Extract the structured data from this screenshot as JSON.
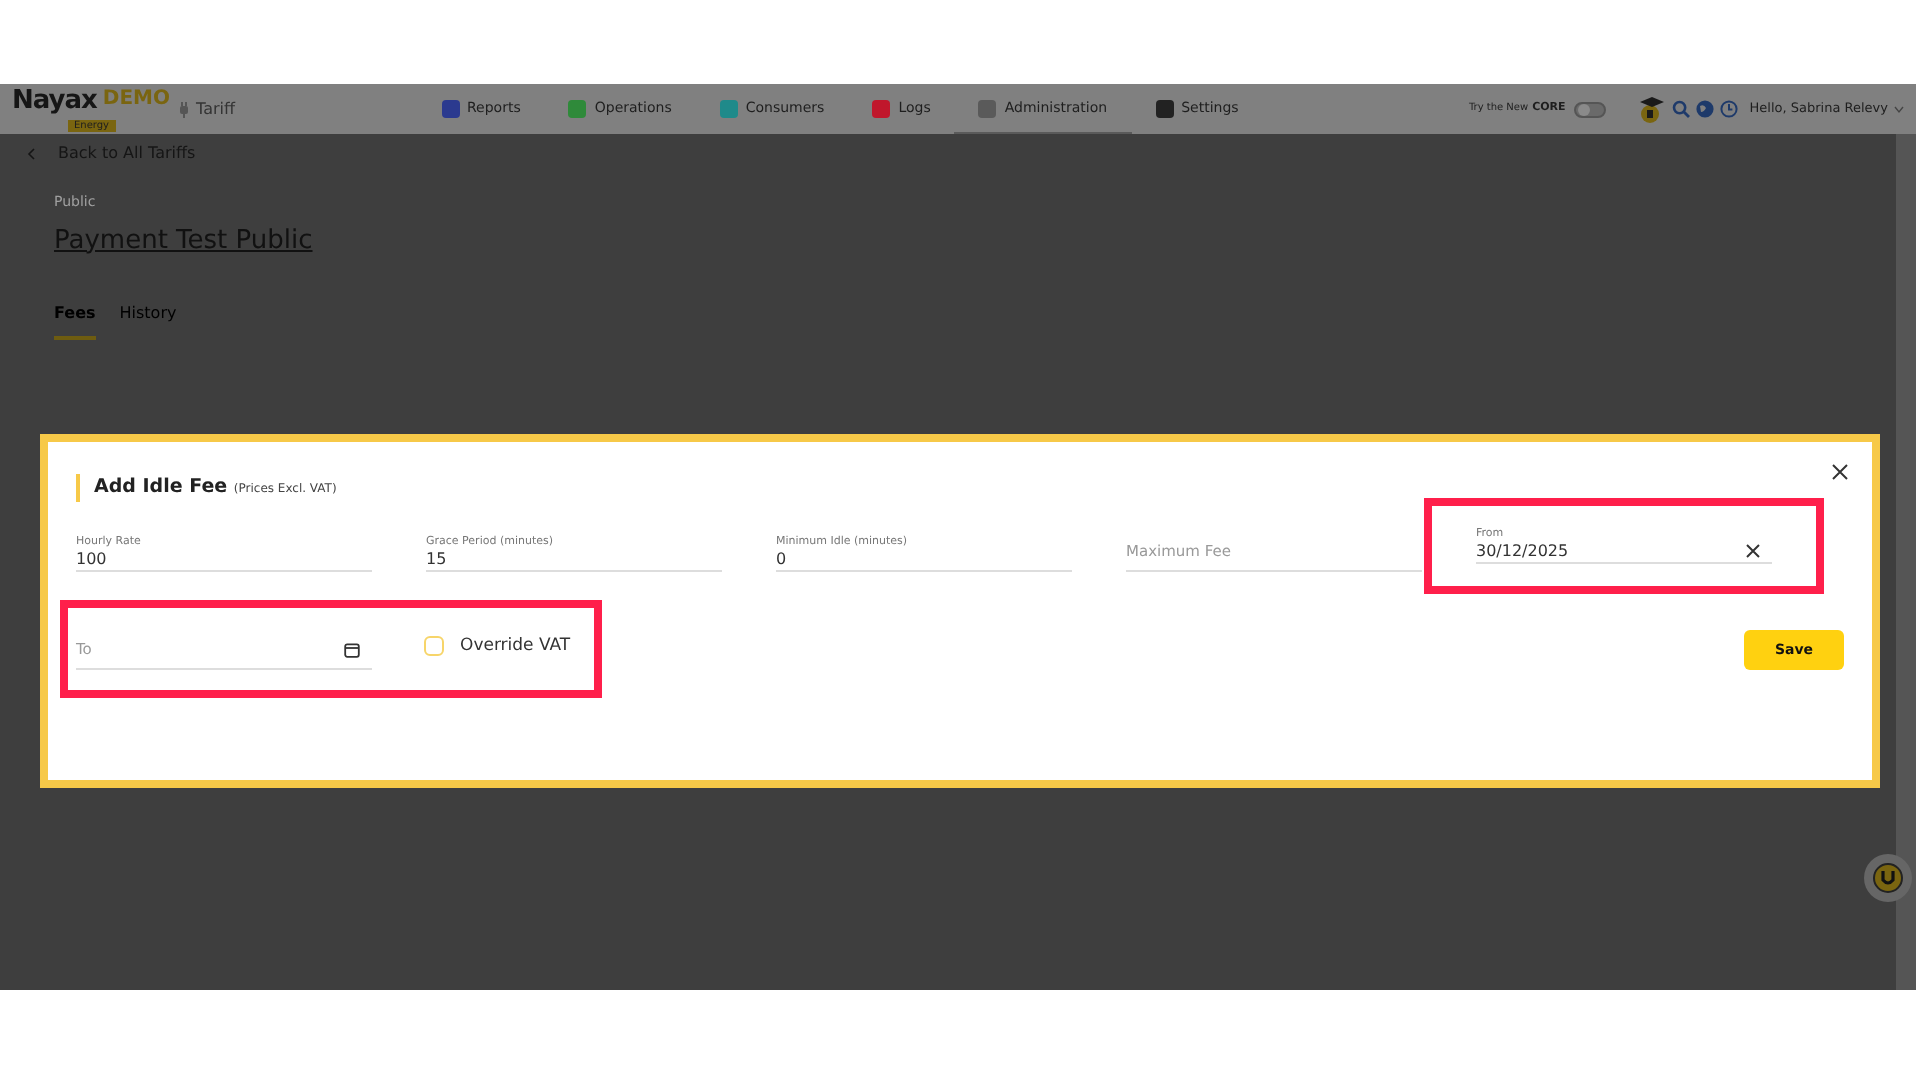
{
  "header": {
    "brand": "Nayax",
    "brand_tag": "DEMO",
    "brand_sub": "Energy",
    "section": "Tariff",
    "nav": [
      {
        "label": "Reports",
        "color": "#2b3a8f",
        "selected": false
      },
      {
        "label": "Operations",
        "color": "#2f8a3a",
        "selected": false
      },
      {
        "label": "Consumers",
        "color": "#1f8a8a",
        "selected": false
      },
      {
        "label": "Logs",
        "color": "#c0172c",
        "selected": false
      },
      {
        "label": "Administration",
        "color": "#5a5a5a",
        "selected": true
      },
      {
        "label": "Settings",
        "color": "#222222",
        "selected": false
      }
    ],
    "try_text": "Try the New",
    "try_brand": "CORE",
    "try_toggle": {
      "on": false
    },
    "user": "Hello, Sabrina Relevy"
  },
  "page": {
    "back": "Back to All Tariffs",
    "kicker": "Public",
    "title": "Payment Test Public",
    "tabs": [
      {
        "label": "Fees",
        "selected": true
      },
      {
        "label": "History",
        "selected": false
      }
    ]
  },
  "modal": {
    "title": "Add Idle Fee",
    "subtitle": "(Prices Excl. VAT)",
    "fields": [
      {
        "label": "Hourly Rate",
        "value": "100",
        "highlighted": false,
        "kind": "text"
      },
      {
        "label": "Grace Period (minutes)",
        "value": "15",
        "highlighted": false,
        "kind": "text"
      },
      {
        "label": "Minimum Idle (minutes)",
        "value": "0",
        "highlighted": false,
        "kind": "text"
      },
      {
        "placeholder": "Maximum Fee",
        "highlighted": false,
        "kind": "text"
      },
      {
        "label": "From",
        "value": "30/12/2025",
        "highlighted": true,
        "kind": "clearable"
      }
    ],
    "second_row": {
      "highlighted": true,
      "to": {
        "placeholder": "To"
      },
      "override_vat": {
        "label": "Override VAT",
        "checked": false
      }
    },
    "save": "Save"
  }
}
